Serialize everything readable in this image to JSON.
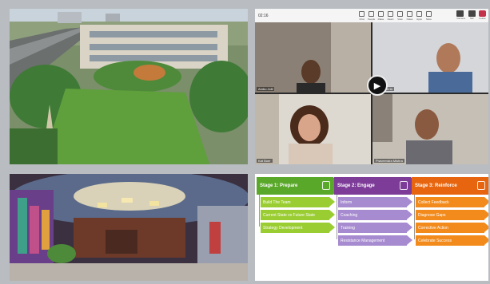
{
  "meeting": {
    "time": "02:16",
    "tools": [
      "Chat",
      "People",
      "Raise",
      "React",
      "View",
      "Notes",
      "Apps",
      "More"
    ],
    "right_tools": [
      "Camera",
      "Mic",
      "Leave"
    ],
    "participants": [
      {
        "name": "Ambu Jolil"
      },
      {
        "name": "Deen Tra la"
      },
      {
        "name": "Kat Boer"
      },
      {
        "name": "Praveendra Mishra"
      }
    ]
  },
  "framework": {
    "colors": {
      "green": "#5aa82a",
      "green_light": "#9acd32",
      "purple": "#7d3c98",
      "purple_light": "#a78bd0",
      "orange": "#e8650f",
      "orange_light": "#f28b1c"
    },
    "stages": [
      {
        "title": "Stage 1: Prepare",
        "icon": "clipboard-icon",
        "items": [
          "Build The Team",
          "Current State vs Future State",
          "Strategy Development"
        ]
      },
      {
        "title": "Stage 2: Engage",
        "icon": "people-icon",
        "items": [
          "Inform",
          "Coaching",
          "Training",
          "Resistance Management"
        ]
      },
      {
        "title": "Stage 3: Reinforce",
        "icon": "people-icon",
        "items": [
          "Collect Feedback",
          "Diagnose Gaps",
          "Corrective Action",
          "Celebrate Success"
        ]
      }
    ]
  }
}
